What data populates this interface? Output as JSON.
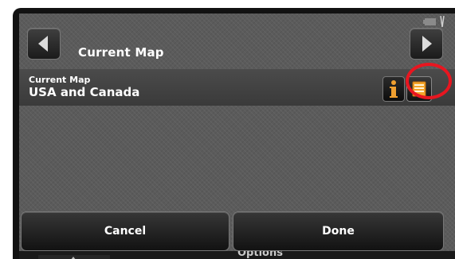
{
  "header": {
    "title": "Current Map",
    "prev_icon": "left-arrow-icon",
    "next_icon": "right-arrow-icon"
  },
  "map_row": {
    "label": "Current Map",
    "value": "USA and Canada",
    "info_icon": "info-icon",
    "list_icon": "map-list-icon",
    "highlight_color": "#e81620"
  },
  "footer": {
    "cancel_label": "Cancel",
    "done_label": "Done"
  },
  "background_menu": {
    "label": "Options"
  }
}
